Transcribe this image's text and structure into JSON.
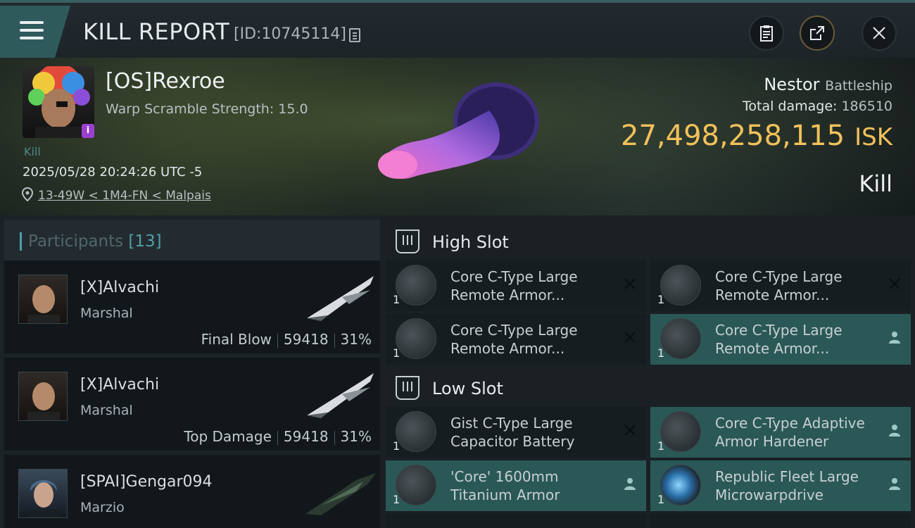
{
  "header": {
    "menu_label": "Menu",
    "title": "KILL REPORT",
    "report_id": "[ID:10745114]"
  },
  "victim": {
    "name": "[OS]Rexroe",
    "warp_scramble": "Warp Scramble Strength: 15.0",
    "kill_tag": "Kill",
    "datetime": "2025/05/28 20:24:26 UTC -5",
    "location": "13-49W < 1M4-FN < Malpais",
    "ship_name": "Nestor",
    "ship_class": "Battleship",
    "total_damage_label": "Total damage:",
    "total_damage": "186510",
    "isk_value": "27,498,258,115",
    "isk_unit": "ISK",
    "result": "Kill"
  },
  "participants": {
    "label": "Participants",
    "count": "[13]",
    "rows": [
      {
        "name": "[X]Alvachi",
        "ship": "Marshal",
        "role": "Final Blow",
        "damage": "59418",
        "percent": "31%"
      },
      {
        "name": "[X]Alvachi",
        "ship": "Marshal",
        "role": "Top Damage",
        "damage": "59418",
        "percent": "31%"
      },
      {
        "name": "[SPAI]Gengar094",
        "ship": "Marzio",
        "role": "",
        "damage": "",
        "percent": ""
      }
    ]
  },
  "slots": {
    "high_label": "High Slot",
    "low_label": "Low Slot",
    "high": [
      {
        "name": "Core C-Type Large Remote Armor...",
        "qty": "1",
        "status": "destroyed"
      },
      {
        "name": "Core C-Type Large Remote Armor...",
        "qty": "1",
        "status": "destroyed"
      },
      {
        "name": "Core C-Type Large Remote Armor...",
        "qty": "1",
        "status": "destroyed"
      },
      {
        "name": "Core C-Type Large Remote Armor...",
        "qty": "1",
        "status": "dropped"
      }
    ],
    "low": [
      {
        "name": "Gist C-Type Large Capacitor Battery",
        "qty": "1",
        "status": "destroyed"
      },
      {
        "name": "Core C-Type Adaptive Armor Hardener",
        "qty": "1",
        "status": "dropped"
      },
      {
        "name": "'Core' 1600mm Titanium Armor",
        "qty": "1",
        "status": "dropped"
      },
      {
        "name": "Republic Fleet Large Microwarpdrive",
        "qty": "1",
        "status": "dropped"
      }
    ]
  },
  "colors": {
    "accent": "#4fa2a6",
    "isk": "#f2c15a",
    "dropped_bg": "#2a5857",
    "destroyed_bg": "#161d20"
  }
}
